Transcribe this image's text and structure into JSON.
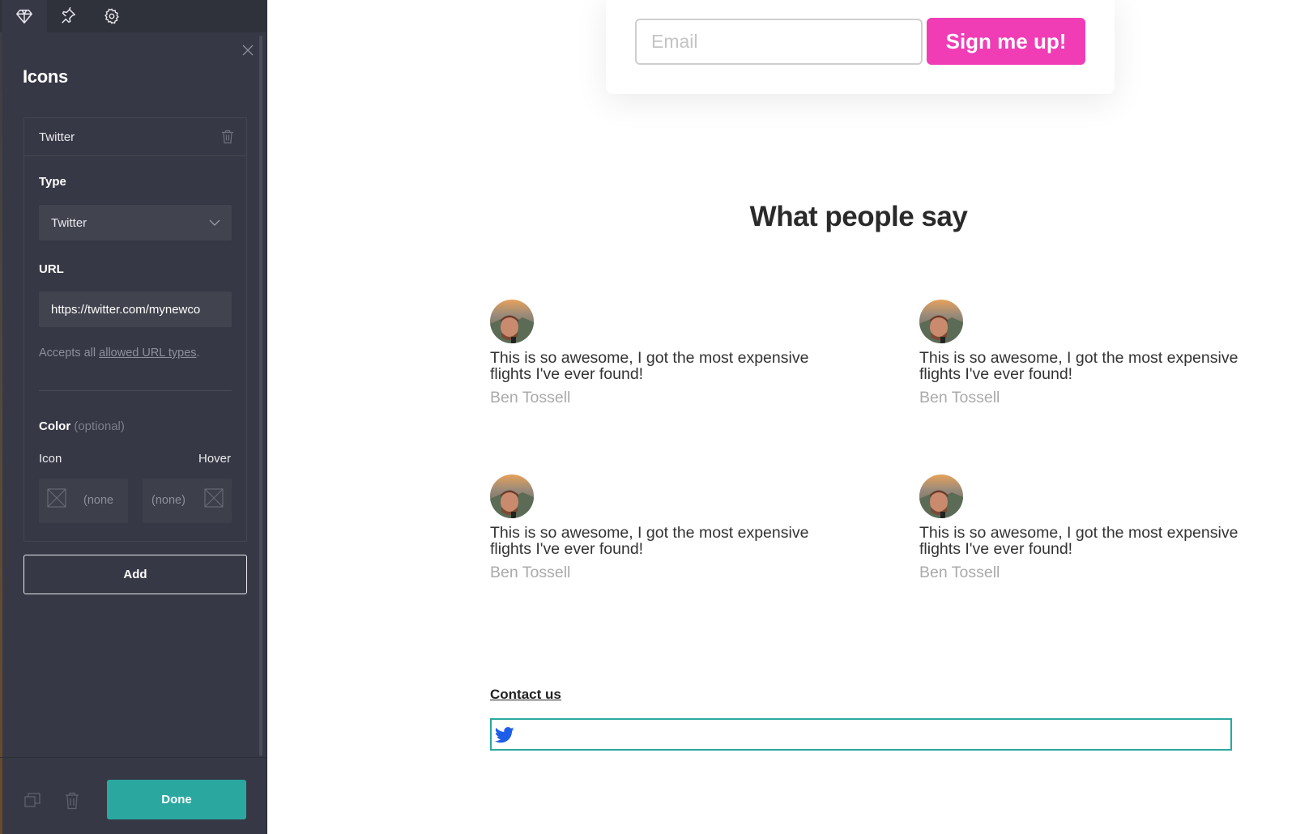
{
  "sidebar": {
    "tabs": [
      {
        "name": "diamond-icon"
      },
      {
        "name": "pin-icon"
      },
      {
        "name": "gear-icon"
      }
    ],
    "panel_title": "Icons",
    "item": {
      "header_label": "Twitter",
      "type_label": "Type",
      "type_value": "Twitter",
      "url_label": "URL",
      "url_value": "https://twitter.com/mynewco",
      "hint_prefix": "Accepts all ",
      "hint_link": "allowed URL types",
      "hint_suffix": ".",
      "color_label": "Color",
      "color_optional": "(optional)",
      "icon_label": "Icon",
      "hover_label": "Hover",
      "icon_value": "(none",
      "hover_value": "(none)"
    },
    "add_label": "Add",
    "done_label": "Done",
    "accent_color": "#2aa8a0"
  },
  "page": {
    "signup": {
      "email_placeholder": "Email",
      "button_label": "Sign me up!",
      "button_color": "#f03db5"
    },
    "section_title": "What people say",
    "testimonials": [
      {
        "quote": "This is so awesome, I got the most expensive flights I've ever found!",
        "author": "Ben Tossell"
      },
      {
        "quote": "This is so awesome, I got the most expensive flights I've ever found!",
        "author": "Ben Tossell"
      },
      {
        "quote": "This is so awesome, I got the most expensive flights I've ever found!",
        "author": "Ben Tossell"
      },
      {
        "quote": "This is so awesome, I got the most expensive flights I've ever found!",
        "author": "Ben Tossell"
      }
    ],
    "contact_label": "Contact us",
    "social_icon": "twitter-icon"
  }
}
